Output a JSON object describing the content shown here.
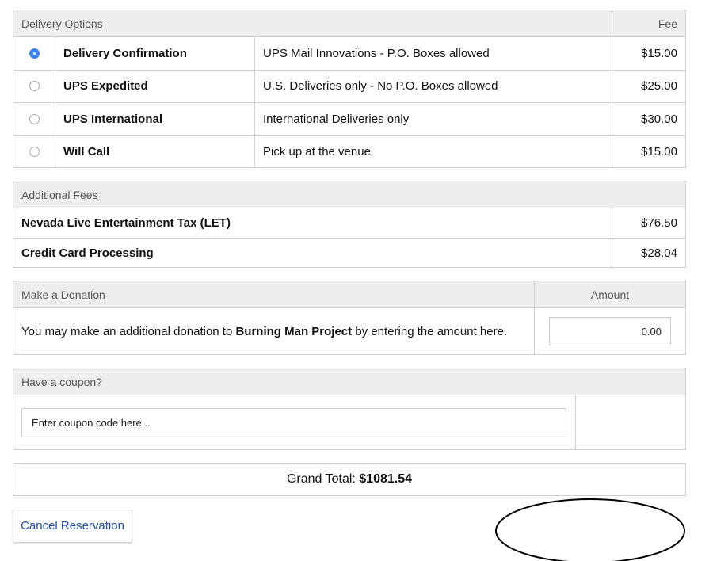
{
  "delivery": {
    "header": "Delivery Options",
    "fee_header": "Fee",
    "options": [
      {
        "name": "Delivery Confirmation",
        "description": "UPS Mail Innovations - P.O. Boxes allowed",
        "fee": "$15.00",
        "selected": true
      },
      {
        "name": "UPS Expedited",
        "description": "U.S. Deliveries only - No P.O. Boxes allowed",
        "fee": "$25.00",
        "selected": false
      },
      {
        "name": "UPS International",
        "description": "International Deliveries only",
        "fee": "$30.00",
        "selected": false
      },
      {
        "name": "Will Call",
        "description": "Pick up at the venue",
        "fee": "$15.00",
        "selected": false
      }
    ]
  },
  "fees": {
    "header": "Additional Fees",
    "items": [
      {
        "label": "Nevada Live Entertainment Tax (LET)",
        "amount": "$76.50"
      },
      {
        "label": "Credit Card Processing",
        "amount": "$28.04"
      }
    ]
  },
  "donation": {
    "header": "Make a Donation",
    "amount_header": "Amount",
    "text_before": "You may make an additional donation to ",
    "org": "Burning Man Project",
    "text_after": " by entering the amount here.",
    "value": "0.00"
  },
  "coupon": {
    "header": "Have a coupon?",
    "placeholder": "Enter coupon code here..."
  },
  "total": {
    "label": "Grand Total: ",
    "amount": "$1081.54"
  },
  "actions": {
    "cancel_label": "Cancel Reservation"
  },
  "colors": {
    "accent": "#3b82f0",
    "link": "#1f4fb4",
    "header_bg": "#eeeeee",
    "border": "#cfcfcf"
  }
}
